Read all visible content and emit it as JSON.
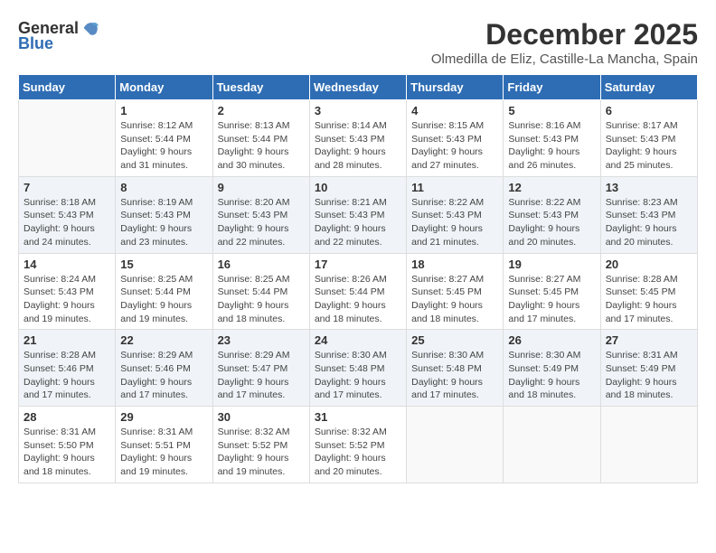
{
  "logo": {
    "text_general": "General",
    "text_blue": "Blue"
  },
  "title": "December 2025",
  "subtitle": "Olmedilla de Eliz, Castille-La Mancha, Spain",
  "columns": [
    "Sunday",
    "Monday",
    "Tuesday",
    "Wednesday",
    "Thursday",
    "Friday",
    "Saturday"
  ],
  "weeks": [
    [
      {
        "day": "",
        "sunrise": "",
        "sunset": "",
        "daylight": ""
      },
      {
        "day": "1",
        "sunrise": "Sunrise: 8:12 AM",
        "sunset": "Sunset: 5:44 PM",
        "daylight": "Daylight: 9 hours and 31 minutes."
      },
      {
        "day": "2",
        "sunrise": "Sunrise: 8:13 AM",
        "sunset": "Sunset: 5:44 PM",
        "daylight": "Daylight: 9 hours and 30 minutes."
      },
      {
        "day": "3",
        "sunrise": "Sunrise: 8:14 AM",
        "sunset": "Sunset: 5:43 PM",
        "daylight": "Daylight: 9 hours and 28 minutes."
      },
      {
        "day": "4",
        "sunrise": "Sunrise: 8:15 AM",
        "sunset": "Sunset: 5:43 PM",
        "daylight": "Daylight: 9 hours and 27 minutes."
      },
      {
        "day": "5",
        "sunrise": "Sunrise: 8:16 AM",
        "sunset": "Sunset: 5:43 PM",
        "daylight": "Daylight: 9 hours and 26 minutes."
      },
      {
        "day": "6",
        "sunrise": "Sunrise: 8:17 AM",
        "sunset": "Sunset: 5:43 PM",
        "daylight": "Daylight: 9 hours and 25 minutes."
      }
    ],
    [
      {
        "day": "7",
        "sunrise": "Sunrise: 8:18 AM",
        "sunset": "Sunset: 5:43 PM",
        "daylight": "Daylight: 9 hours and 24 minutes."
      },
      {
        "day": "8",
        "sunrise": "Sunrise: 8:19 AM",
        "sunset": "Sunset: 5:43 PM",
        "daylight": "Daylight: 9 hours and 23 minutes."
      },
      {
        "day": "9",
        "sunrise": "Sunrise: 8:20 AM",
        "sunset": "Sunset: 5:43 PM",
        "daylight": "Daylight: 9 hours and 22 minutes."
      },
      {
        "day": "10",
        "sunrise": "Sunrise: 8:21 AM",
        "sunset": "Sunset: 5:43 PM",
        "daylight": "Daylight: 9 hours and 22 minutes."
      },
      {
        "day": "11",
        "sunrise": "Sunrise: 8:22 AM",
        "sunset": "Sunset: 5:43 PM",
        "daylight": "Daylight: 9 hours and 21 minutes."
      },
      {
        "day": "12",
        "sunrise": "Sunrise: 8:22 AM",
        "sunset": "Sunset: 5:43 PM",
        "daylight": "Daylight: 9 hours and 20 minutes."
      },
      {
        "day": "13",
        "sunrise": "Sunrise: 8:23 AM",
        "sunset": "Sunset: 5:43 PM",
        "daylight": "Daylight: 9 hours and 20 minutes."
      }
    ],
    [
      {
        "day": "14",
        "sunrise": "Sunrise: 8:24 AM",
        "sunset": "Sunset: 5:43 PM",
        "daylight": "Daylight: 9 hours and 19 minutes."
      },
      {
        "day": "15",
        "sunrise": "Sunrise: 8:25 AM",
        "sunset": "Sunset: 5:44 PM",
        "daylight": "Daylight: 9 hours and 19 minutes."
      },
      {
        "day": "16",
        "sunrise": "Sunrise: 8:25 AM",
        "sunset": "Sunset: 5:44 PM",
        "daylight": "Daylight: 9 hours and 18 minutes."
      },
      {
        "day": "17",
        "sunrise": "Sunrise: 8:26 AM",
        "sunset": "Sunset: 5:44 PM",
        "daylight": "Daylight: 9 hours and 18 minutes."
      },
      {
        "day": "18",
        "sunrise": "Sunrise: 8:27 AM",
        "sunset": "Sunset: 5:45 PM",
        "daylight": "Daylight: 9 hours and 18 minutes."
      },
      {
        "day": "19",
        "sunrise": "Sunrise: 8:27 AM",
        "sunset": "Sunset: 5:45 PM",
        "daylight": "Daylight: 9 hours and 17 minutes."
      },
      {
        "day": "20",
        "sunrise": "Sunrise: 8:28 AM",
        "sunset": "Sunset: 5:45 PM",
        "daylight": "Daylight: 9 hours and 17 minutes."
      }
    ],
    [
      {
        "day": "21",
        "sunrise": "Sunrise: 8:28 AM",
        "sunset": "Sunset: 5:46 PM",
        "daylight": "Daylight: 9 hours and 17 minutes."
      },
      {
        "day": "22",
        "sunrise": "Sunrise: 8:29 AM",
        "sunset": "Sunset: 5:46 PM",
        "daylight": "Daylight: 9 hours and 17 minutes."
      },
      {
        "day": "23",
        "sunrise": "Sunrise: 8:29 AM",
        "sunset": "Sunset: 5:47 PM",
        "daylight": "Daylight: 9 hours and 17 minutes."
      },
      {
        "day": "24",
        "sunrise": "Sunrise: 8:30 AM",
        "sunset": "Sunset: 5:48 PM",
        "daylight": "Daylight: 9 hours and 17 minutes."
      },
      {
        "day": "25",
        "sunrise": "Sunrise: 8:30 AM",
        "sunset": "Sunset: 5:48 PM",
        "daylight": "Daylight: 9 hours and 17 minutes."
      },
      {
        "day": "26",
        "sunrise": "Sunrise: 8:30 AM",
        "sunset": "Sunset: 5:49 PM",
        "daylight": "Daylight: 9 hours and 18 minutes."
      },
      {
        "day": "27",
        "sunrise": "Sunrise: 8:31 AM",
        "sunset": "Sunset: 5:49 PM",
        "daylight": "Daylight: 9 hours and 18 minutes."
      }
    ],
    [
      {
        "day": "28",
        "sunrise": "Sunrise: 8:31 AM",
        "sunset": "Sunset: 5:50 PM",
        "daylight": "Daylight: 9 hours and 18 minutes."
      },
      {
        "day": "29",
        "sunrise": "Sunrise: 8:31 AM",
        "sunset": "Sunset: 5:51 PM",
        "daylight": "Daylight: 9 hours and 19 minutes."
      },
      {
        "day": "30",
        "sunrise": "Sunrise: 8:32 AM",
        "sunset": "Sunset: 5:52 PM",
        "daylight": "Daylight: 9 hours and 19 minutes."
      },
      {
        "day": "31",
        "sunrise": "Sunrise: 8:32 AM",
        "sunset": "Sunset: 5:52 PM",
        "daylight": "Daylight: 9 hours and 20 minutes."
      },
      {
        "day": "",
        "sunrise": "",
        "sunset": "",
        "daylight": ""
      },
      {
        "day": "",
        "sunrise": "",
        "sunset": "",
        "daylight": ""
      },
      {
        "day": "",
        "sunrise": "",
        "sunset": "",
        "daylight": ""
      }
    ]
  ]
}
